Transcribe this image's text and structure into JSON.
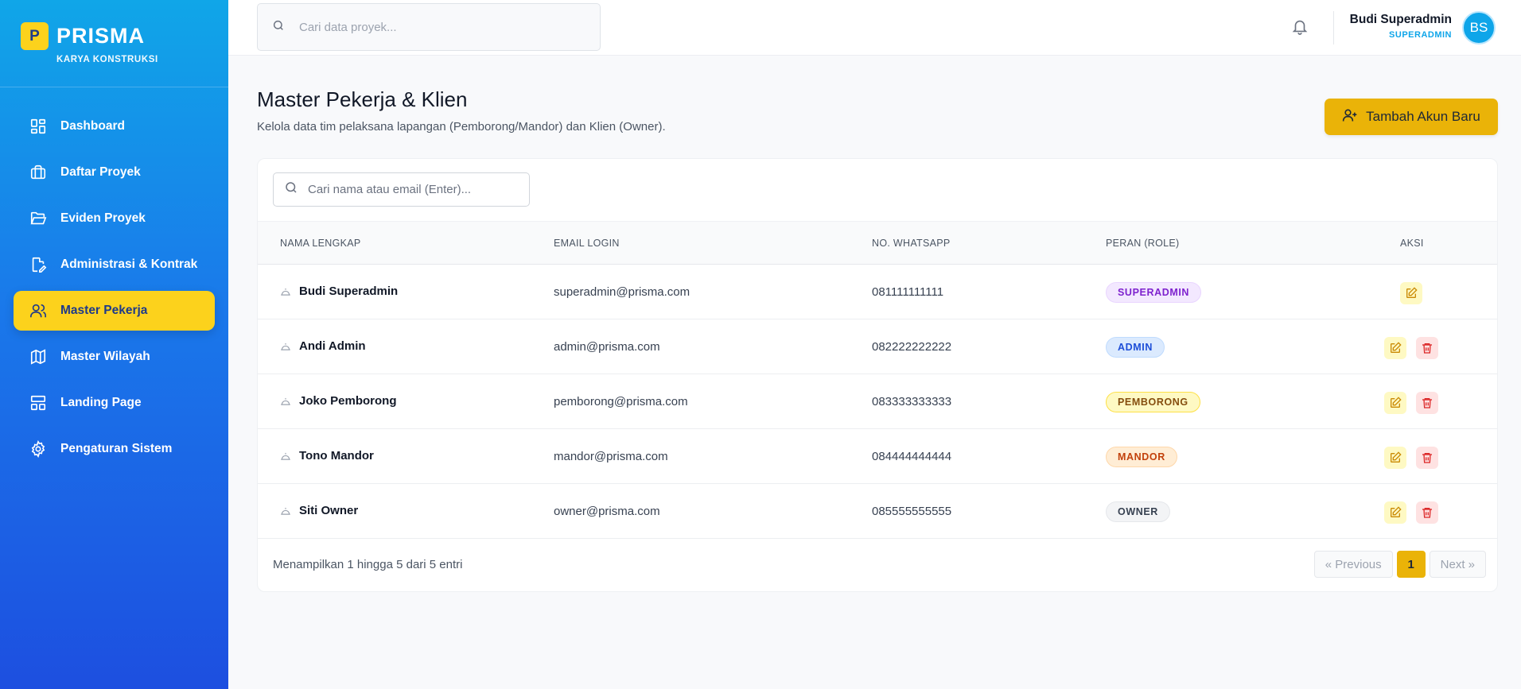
{
  "brand": {
    "logo_letter": "P",
    "name": "PRISMA",
    "subtitle": "KARYA KONSTRUKSI"
  },
  "sidebar": {
    "items": [
      {
        "label": "Dashboard",
        "icon": "dashboard-grid-icon"
      },
      {
        "label": "Daftar Proyek",
        "icon": "briefcase-icon"
      },
      {
        "label": "Eviden Proyek",
        "icon": "folder-open-icon"
      },
      {
        "label": "Administrasi & Kontrak",
        "icon": "document-edit-icon"
      },
      {
        "label": "Master Pekerja",
        "icon": "users-icon",
        "active": true
      },
      {
        "label": "Master Wilayah",
        "icon": "map-icon"
      },
      {
        "label": "Landing Page",
        "icon": "layout-icon"
      },
      {
        "label": "Pengaturan Sistem",
        "icon": "gear-icon"
      }
    ]
  },
  "topbar": {
    "search_placeholder": "Cari data proyek...",
    "user_name": "Budi Superadmin",
    "user_role": "SUPERADMIN",
    "avatar_initials": "BS"
  },
  "page": {
    "title": "Master Pekerja & Klien",
    "subtitle": "Kelola data tim pelaksana lapangan (Pemborong/Mandor) dan Klien (Owner).",
    "add_button_label": "Tambah Akun Baru"
  },
  "table": {
    "search_placeholder": "Cari nama atau email (Enter)...",
    "headers": {
      "name": "NAMA LENGKAP",
      "email": "EMAIL LOGIN",
      "whatsapp": "NO. WHATSAPP",
      "role": "PERAN (ROLE)",
      "action": "AKSI"
    },
    "rows": [
      {
        "name": "Budi Superadmin",
        "email": "superadmin@prisma.com",
        "whatsapp": "081111111111",
        "role": "SUPERADMIN",
        "deletable": false
      },
      {
        "name": "Andi Admin",
        "email": "admin@prisma.com",
        "whatsapp": "082222222222",
        "role": "ADMIN",
        "deletable": true
      },
      {
        "name": "Joko Pemborong",
        "email": "pemborong@prisma.com",
        "whatsapp": "083333333333",
        "role": "PEMBORONG",
        "deletable": true
      },
      {
        "name": "Tono Mandor",
        "email": "mandor@prisma.com",
        "whatsapp": "084444444444",
        "role": "MANDOR",
        "deletable": true
      },
      {
        "name": "Siti Owner",
        "email": "owner@prisma.com",
        "whatsapp": "085555555555",
        "role": "OWNER",
        "deletable": true
      }
    ],
    "footer_info": "Menampilkan 1 hingga 5 dari 5 entri",
    "pagination": {
      "previous": "« Previous",
      "current": "1",
      "next": "Next »"
    }
  },
  "colors": {
    "accent_yellow": "#eab308",
    "sidebar_active": "#fcd21c",
    "role_superadmin": "#7e22ce",
    "role_admin": "#1d4ed8",
    "role_pemborong": "#854d0e",
    "role_mandor": "#c2410c",
    "role_owner": "#374151"
  }
}
